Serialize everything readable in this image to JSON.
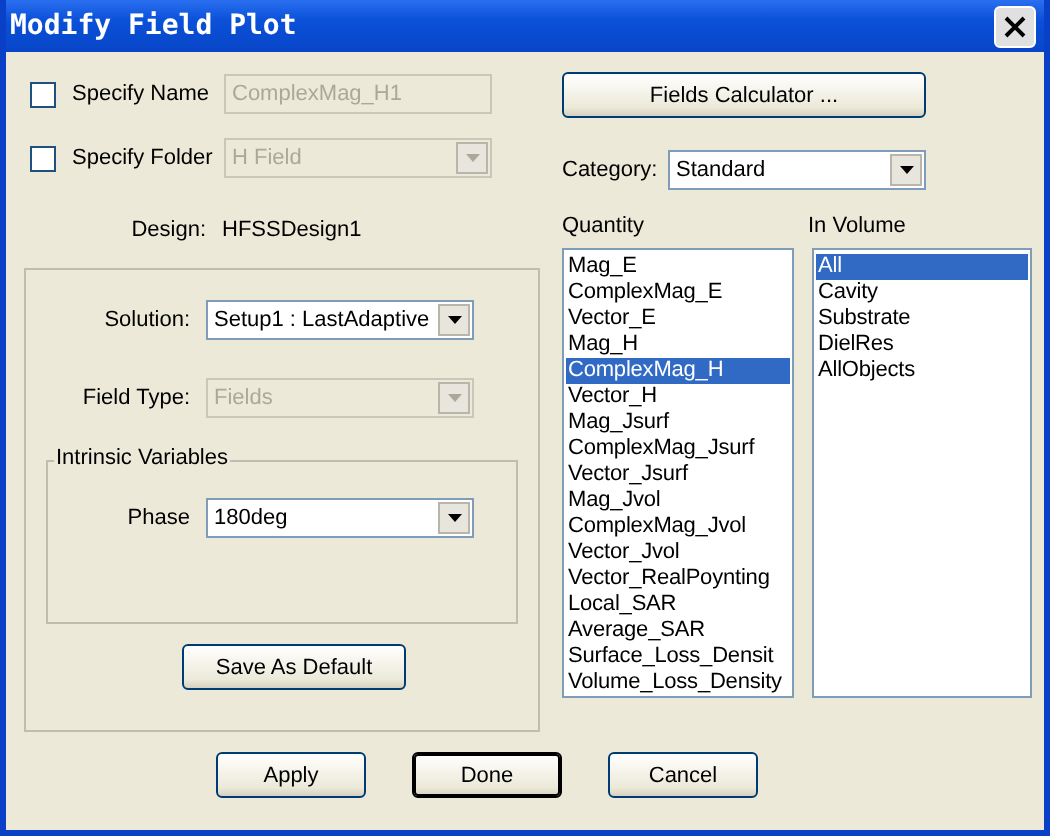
{
  "window": {
    "title": "Modify Field Plot"
  },
  "specify_name": {
    "label": "Specify Name",
    "checked": false,
    "value": "ComplexMag_H1",
    "disabled": true
  },
  "specify_folder": {
    "label": "Specify Folder",
    "checked": false,
    "value": "H Field",
    "disabled": true
  },
  "design": {
    "label": "Design:",
    "value": "HFSSDesign1"
  },
  "solution": {
    "label": "Solution:",
    "value": "Setup1 : LastAdaptive",
    "disabled": false
  },
  "field_type": {
    "label": "Field Type:",
    "value": "Fields",
    "disabled": true
  },
  "intrinsic_variables": {
    "title": "Intrinsic Variables",
    "label": "Phase",
    "value": "180deg",
    "disabled": false
  },
  "save_default_button": "Save As Default",
  "fields_calculator_button": "Fields Calculator ...",
  "category": {
    "label": "Category:",
    "value": "Standard",
    "disabled": false
  },
  "quantity": {
    "title": "Quantity",
    "items": [
      {
        "label": "Mag_E",
        "selected": false
      },
      {
        "label": "ComplexMag_E",
        "selected": false
      },
      {
        "label": "Vector_E",
        "selected": false
      },
      {
        "label": "Mag_H",
        "selected": false
      },
      {
        "label": "ComplexMag_H",
        "selected": true
      },
      {
        "label": "Vector_H",
        "selected": false
      },
      {
        "label": "Mag_Jsurf",
        "selected": false
      },
      {
        "label": "ComplexMag_Jsurf",
        "selected": false
      },
      {
        "label": "Vector_Jsurf",
        "selected": false
      },
      {
        "label": "Mag_Jvol",
        "selected": false
      },
      {
        "label": "ComplexMag_Jvol",
        "selected": false
      },
      {
        "label": "Vector_Jvol",
        "selected": false
      },
      {
        "label": "Vector_RealPoynting",
        "selected": false
      },
      {
        "label": "Local_SAR",
        "selected": false
      },
      {
        "label": "Average_SAR",
        "selected": false
      },
      {
        "label": "Surface_Loss_Densit",
        "selected": false
      },
      {
        "label": "Volume_Loss_Density",
        "selected": false
      }
    ]
  },
  "in_volume": {
    "title": "In Volume",
    "items": [
      {
        "label": "All",
        "selected": true
      },
      {
        "label": "Cavity",
        "selected": false
      },
      {
        "label": "Substrate",
        "selected": false
      },
      {
        "label": "DielRes",
        "selected": false
      },
      {
        "label": "AllObjects",
        "selected": false
      }
    ]
  },
  "buttons": [
    {
      "label": "Apply",
      "default": false
    },
    {
      "label": "Done",
      "default": true
    },
    {
      "label": "Cancel",
      "default": false
    }
  ]
}
